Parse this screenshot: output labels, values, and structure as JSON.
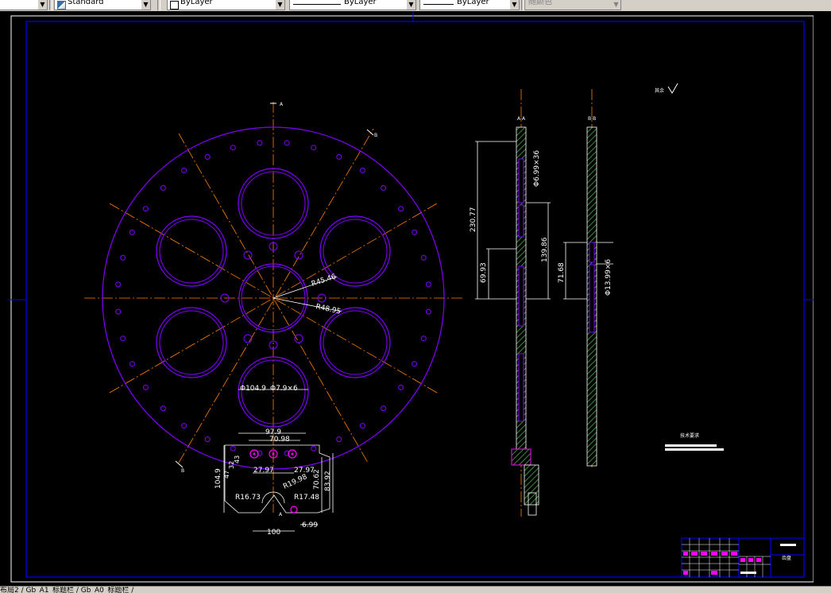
{
  "toolbar": {
    "textstyle": {
      "value": "Standard",
      "icon": "text-style-icon"
    },
    "layer": {
      "value": "ByLayer",
      "icon": "color-swatch-icon"
    },
    "linetype": {
      "value": "ByLayer"
    },
    "lineweight": {
      "value": "ByLayer"
    },
    "plotstyle": {
      "value": "随颜色"
    }
  },
  "drawing": {
    "section_labels": {
      "a_top": "A",
      "b_top": "B",
      "b_bottom": "B",
      "a_bottom": "A",
      "view_aa": "A-A",
      "view_bb": "B-B"
    },
    "dims_main": {
      "r_outer": "R45.46",
      "r_inner": "R48.95",
      "hole_pattern": "Φ104.9",
      "hole_small": "Φ7.9×6"
    },
    "dims_detail": {
      "w1": "97.9",
      "w2": "70.98",
      "h_total": "104.9",
      "h_a": "43",
      "h_b": "32",
      "h_c": "47",
      "offset_l": "27.97",
      "offset_r": "27.97",
      "r_a": "R19.98",
      "r_b": "R16.73",
      "r_c": "R17.48",
      "h_d": "70.62",
      "h_e": "83.92",
      "base_w": "100",
      "gap": "6.99"
    },
    "dims_section_a": {
      "total": "230.77",
      "upper": "Φ6.99×36",
      "mid": "139.86",
      "lower": "69.93"
    },
    "dims_section_b": {
      "lower": "71.68",
      "hole": "Φ13.99×6"
    },
    "surface_note": "其余",
    "tech_req": "技术要求",
    "title_block": {
      "name": "齿盘"
    }
  },
  "bottom_tabs": "布局2 / Gb_A1_标题栏 / Gb_A0_标题栏 /",
  "colors": {
    "frame": "#0000ff",
    "geometry": "#8000ff",
    "center": "#ff8000",
    "dim": "#ffffff",
    "hatch": "#00ff00",
    "mark": "#ff00ff"
  }
}
